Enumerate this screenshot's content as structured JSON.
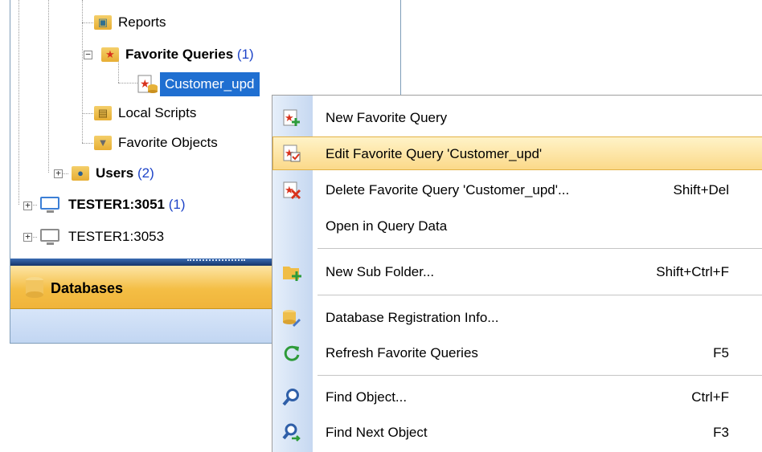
{
  "tree": {
    "reports": {
      "label": "Reports"
    },
    "favorite_queries": {
      "label": "Favorite Queries",
      "count": "(1)"
    },
    "customer_upd": {
      "label": "Customer_upd"
    },
    "local_scripts": {
      "label": "Local Scripts"
    },
    "favorite_objects": {
      "label": "Favorite Objects"
    },
    "users": {
      "label": "Users",
      "count": "(2)"
    },
    "tester_3051": {
      "label": "TESTER1:3051",
      "count": "(1)"
    },
    "tester_3053": {
      "label": "TESTER1:3053"
    }
  },
  "databases_bar": {
    "label": "Databases"
  },
  "context_menu": {
    "items": [
      {
        "label": "New Favorite Query",
        "shortcut": "",
        "icon": "new-favorite-query-icon"
      },
      {
        "label": "Edit Favorite Query 'Customer_upd'",
        "shortcut": "",
        "icon": "edit-favorite-query-icon"
      },
      {
        "label": "Delete Favorite Query 'Customer_upd'...",
        "shortcut": "Shift+Del",
        "icon": "delete-favorite-query-icon"
      },
      {
        "label": "Open in Query Data",
        "shortcut": "",
        "icon": ""
      },
      {
        "label": "New Sub Folder...",
        "shortcut": "Shift+Ctrl+F",
        "icon": "new-folder-icon"
      },
      {
        "label": "Database Registration Info...",
        "shortcut": "",
        "icon": "database-edit-icon"
      },
      {
        "label": "Refresh Favorite Queries",
        "shortcut": "F5",
        "icon": "refresh-icon"
      },
      {
        "label": "Find Object...",
        "shortcut": "Ctrl+F",
        "icon": "search-icon"
      },
      {
        "label": "Find Next Object",
        "shortcut": "F3",
        "icon": "search-next-icon"
      }
    ]
  },
  "colors": {
    "selection": "#1f6fd1",
    "highlight": "#fbd989",
    "count": "#1e44c8"
  }
}
